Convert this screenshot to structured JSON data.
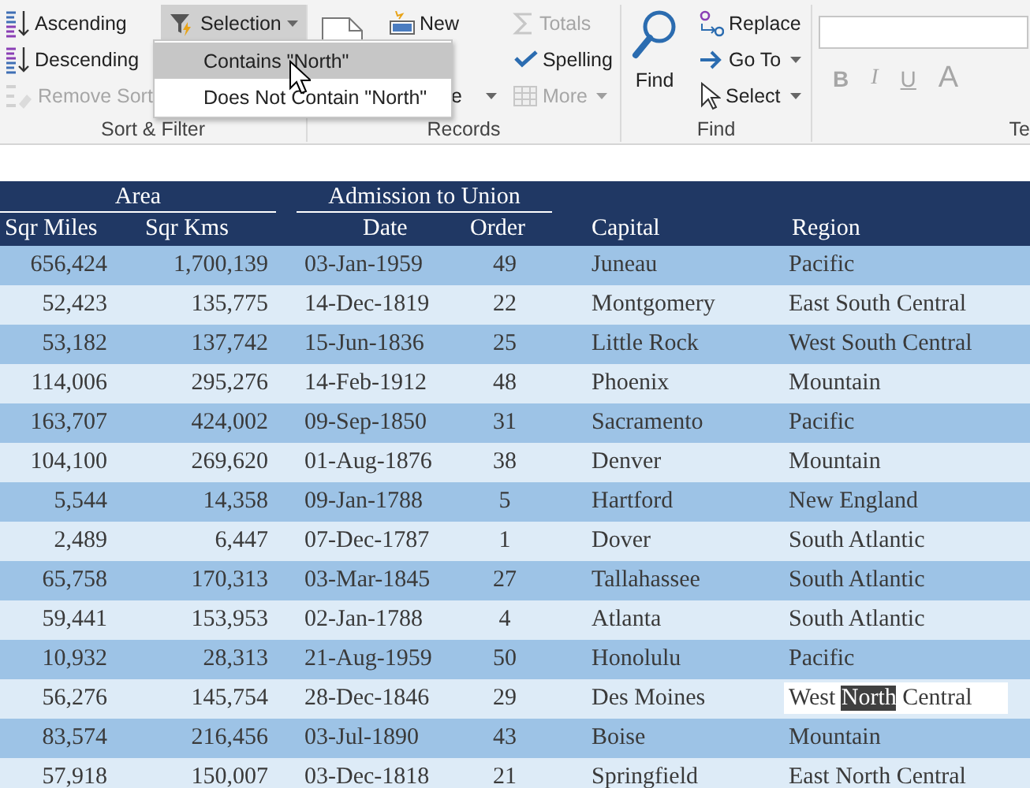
{
  "ribbon": {
    "groups": [
      {
        "kind": "sort_filter",
        "label": "Sort & Filter",
        "items": [
          {
            "label": "Ascending",
            "disabled": false
          },
          {
            "label": "Descending",
            "disabled": false
          },
          {
            "label": "Remove Sort",
            "disabled": true
          }
        ],
        "selection": {
          "label": "Selection",
          "pressed": true,
          "menu": [
            {
              "label": "Contains \"North\"",
              "selected": true
            },
            {
              "label": "Does Not Contain \"North\"",
              "selected": false
            }
          ]
        }
      },
      {
        "kind": "records",
        "label": "Records",
        "items": [
          {
            "label": "New",
            "disabled": false,
            "caret": false
          },
          {
            "label": "e",
            "disabled": false,
            "caret": true
          },
          {
            "label": "Totals",
            "disabled": true,
            "caret": false
          },
          {
            "label": "Spelling",
            "disabled": false,
            "caret": false
          },
          {
            "label": "More",
            "disabled": true,
            "caret": true
          }
        ]
      },
      {
        "kind": "find",
        "label": "Find",
        "big": {
          "label": "Find"
        },
        "items": [
          {
            "label": "Replace",
            "caret": false
          },
          {
            "label": "Go To",
            "caret": true
          },
          {
            "label": "Select",
            "caret": true
          }
        ]
      },
      {
        "kind": "text_format",
        "label": "Te",
        "disabled": true,
        "buttons": [
          {
            "label": "B"
          },
          {
            "label": "I"
          },
          {
            "label": "U"
          },
          {
            "label": "A"
          }
        ]
      }
    ]
  },
  "table": {
    "column_groups": [
      {
        "label": "Area",
        "columns": [
          "Sqr Miles",
          "Sqr Kms"
        ]
      },
      {
        "label": "Admission to Union",
        "columns": [
          "Date",
          "Order"
        ]
      },
      {
        "columns": [
          "Capital",
          "Region"
        ]
      }
    ],
    "rows": [
      {
        "cells": [
          "656,424",
          "1,700,139",
          "03-Jan-1959",
          "49",
          "Juneau",
          "Pacific"
        ]
      },
      {
        "cells": [
          "52,423",
          "135,775",
          "14-Dec-1819",
          "22",
          "Montgomery",
          "East South Central"
        ]
      },
      {
        "cells": [
          "53,182",
          "137,742",
          "15-Jun-1836",
          "25",
          "Little Rock",
          "West South Central"
        ]
      },
      {
        "cells": [
          "114,006",
          "295,276",
          "14-Feb-1912",
          "48",
          "Phoenix",
          "Mountain"
        ]
      },
      {
        "cells": [
          "163,707",
          "424,002",
          "09-Sep-1850",
          "31",
          "Sacramento",
          "Pacific"
        ]
      },
      {
        "cells": [
          "104,100",
          "269,620",
          "01-Aug-1876",
          "38",
          "Denver",
          "Mountain"
        ]
      },
      {
        "cells": [
          "5,544",
          "14,358",
          "09-Jan-1788",
          "5",
          "Hartford",
          "New England"
        ]
      },
      {
        "cells": [
          "2,489",
          "6,447",
          "07-Dec-1787",
          "1",
          "Dover",
          "South Atlantic"
        ]
      },
      {
        "cells": [
          "65,758",
          "170,313",
          "03-Mar-1845",
          "27",
          "Tallahassee",
          "South Atlantic"
        ]
      },
      {
        "cells": [
          "59,441",
          "153,953",
          "02-Jan-1788",
          "4",
          "Atlanta",
          "South Atlantic"
        ]
      },
      {
        "cells": [
          "10,932",
          "28,313",
          "21-Aug-1959",
          "50",
          "Honolulu",
          "Pacific"
        ]
      },
      {
        "cells": [
          "56,276",
          "145,754",
          "28-Dec-1846",
          "29",
          "Des Moines",
          {
            "segments": [
              {
                "text": "West ",
                "selected": false
              },
              {
                "text": "North",
                "selected": true
              },
              {
                "text": " Central",
                "selected": false
              }
            ]
          }
        ]
      },
      {
        "cells": [
          "83,574",
          "216,456",
          "03-Jul-1890",
          "43",
          "Boise",
          "Mountain"
        ]
      },
      {
        "cells": [
          "57,918",
          "150,007",
          "03-Dec-1818",
          "21",
          "Springfield",
          "East North Central"
        ]
      }
    ]
  }
}
